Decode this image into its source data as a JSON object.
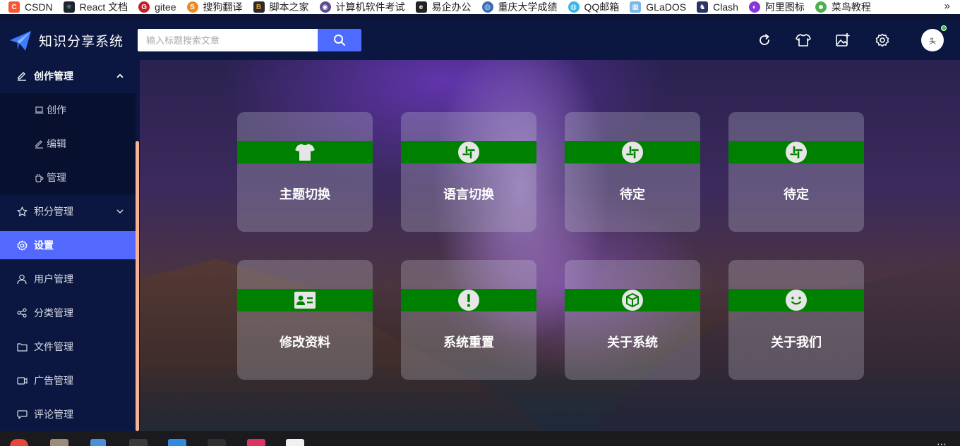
{
  "bookmarks": [
    {
      "label": "CSDN",
      "icon": "csdn-icon",
      "color": "#fc5531",
      "glyph": "C"
    },
    {
      "label": "React 文档",
      "icon": "react-icon",
      "color": "#20232a",
      "glyph": "⚛"
    },
    {
      "label": "gitee",
      "icon": "gitee-icon",
      "color": "#c71d23",
      "glyph": "G"
    },
    {
      "label": "搜狗翻译",
      "icon": "sogou-icon",
      "color": "#f08a1f",
      "glyph": "S"
    },
    {
      "label": "脚本之家",
      "icon": "jb51-icon",
      "color": "#2b2b2b",
      "glyph": "B"
    },
    {
      "label": "计算机软件考试",
      "icon": "ruankao-icon",
      "color": "#5b4a8c",
      "glyph": "◉"
    },
    {
      "label": "易企办公",
      "icon": "yiqi-icon",
      "color": "#222222",
      "glyph": "e"
    },
    {
      "label": "重庆大学成绩",
      "icon": "cqu-icon",
      "color": "#3a6db5",
      "glyph": "◎"
    },
    {
      "label": "QQ邮箱",
      "icon": "qqmail-icon",
      "color": "#3db3e6",
      "glyph": "◍"
    },
    {
      "label": "GLaDOS",
      "icon": "glados-icon",
      "color": "#7bb8e8",
      "glyph": "▦"
    },
    {
      "label": "Clash",
      "icon": "clash-icon",
      "color": "#2a3566",
      "glyph": "♞"
    },
    {
      "label": "阿里图标",
      "icon": "iconfont-icon",
      "color": "#8a35d9",
      "glyph": "◐"
    },
    {
      "label": "菜鸟教程",
      "icon": "runoob-icon",
      "color": "#4caf50",
      "glyph": "☻"
    }
  ],
  "bookmarks_more": "»",
  "header": {
    "title": "知识分享系统",
    "search_placeholder": "输入标题搜索文章"
  },
  "avatar_text": "头",
  "sidebar": {
    "group_create": {
      "label": "创作管理",
      "children": [
        "创作",
        "编辑",
        "管理"
      ]
    },
    "items": [
      "积分管理",
      "设置",
      "用户管理",
      "分类管理",
      "文件管理",
      "广告管理",
      "评论管理"
    ]
  },
  "cards": [
    {
      "label": "主题切换",
      "icon": "shirt-icon"
    },
    {
      "label": "语言切换",
      "icon": "slack-icon"
    },
    {
      "label": "待定",
      "icon": "slack-icon"
    },
    {
      "label": "待定",
      "icon": "slack-icon"
    },
    {
      "label": "修改资料",
      "icon": "id-card-icon"
    },
    {
      "label": "系统重置",
      "icon": "exclamation-icon"
    },
    {
      "label": "关于系统",
      "icon": "box-icon"
    },
    {
      "label": "关于我们",
      "icon": "smile-icon"
    }
  ],
  "colors": {
    "header_bg": "#0b1740",
    "accent": "#5369fd",
    "search_button": "#4d6bfe",
    "card_band": "#008000",
    "scrollbar": "#f7b293"
  }
}
